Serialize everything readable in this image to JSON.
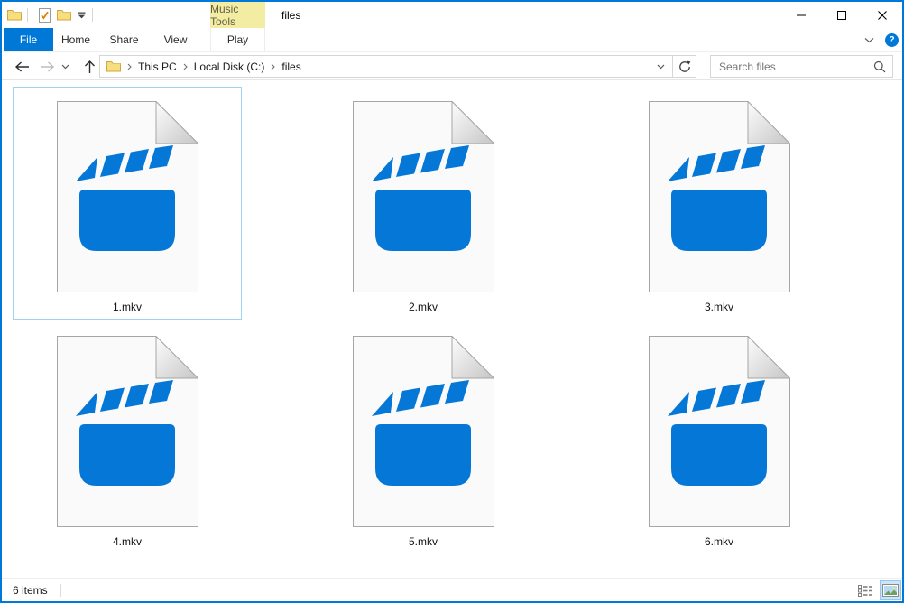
{
  "titlebar": {
    "title": "files",
    "contextual_tab_label": "Music Tools"
  },
  "ribbon": {
    "tabs": [
      {
        "label": "File",
        "active": true
      },
      {
        "label": "Home",
        "active": false
      },
      {
        "label": "Share",
        "active": false
      },
      {
        "label": "View",
        "active": false
      }
    ],
    "contextual_tab_label": "Play"
  },
  "address_bar": {
    "breadcrumb": [
      "This PC",
      "Local Disk (C:)",
      "files"
    ]
  },
  "search": {
    "placeholder": "Search files"
  },
  "files": [
    {
      "name": "1.mkv",
      "selected": true
    },
    {
      "name": "2.mkv",
      "selected": false
    },
    {
      "name": "3.mkv",
      "selected": false
    },
    {
      "name": "4.mkv",
      "selected": false
    },
    {
      "name": "5.mkv",
      "selected": false
    },
    {
      "name": "6.mkv",
      "selected": false
    }
  ],
  "status_bar": {
    "items_count": "6 items"
  },
  "colors": {
    "accent": "#0078d7",
    "file_icon_blue": "#0578d7",
    "selection_border": "#9fd3f2",
    "contextual_tab_bg": "#f2eda3"
  }
}
